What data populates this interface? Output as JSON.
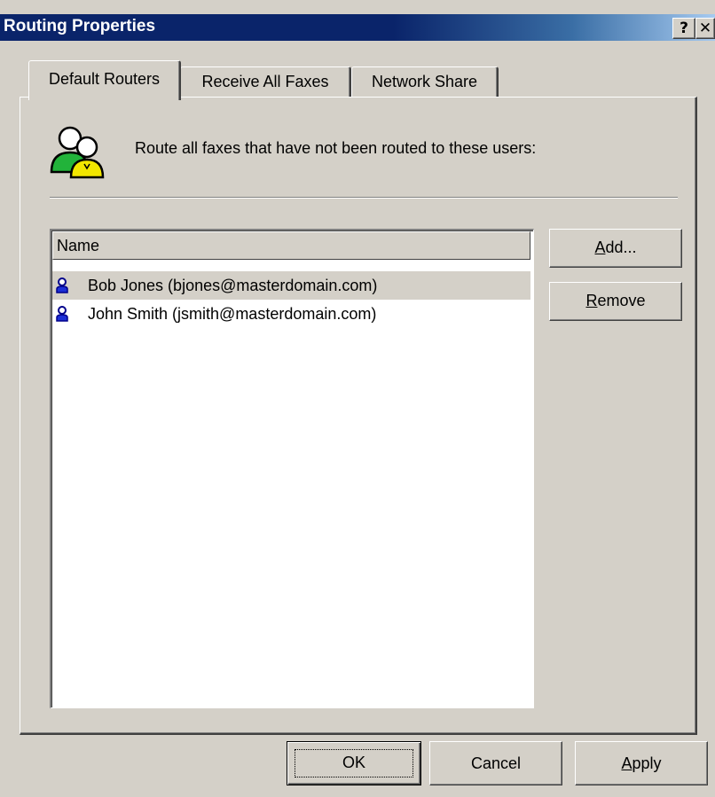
{
  "window": {
    "title": "Routing Properties",
    "help_button": "?",
    "close_button": "✕"
  },
  "tabs": [
    {
      "label": "Default Routers",
      "active": true
    },
    {
      "label": "Receive All Faxes",
      "active": false
    },
    {
      "label": "Network Share",
      "active": false
    }
  ],
  "instruction": "Route all faxes that have not been routed to these users:",
  "list": {
    "column_header": "Name",
    "rows": [
      {
        "text": "Bob Jones (bjones@masterdomain.com)",
        "selected": true
      },
      {
        "text": "John Smith (jsmith@masterdomain.com)",
        "selected": false
      }
    ]
  },
  "buttons": {
    "add": {
      "mnemonic": "A",
      "rest": "dd..."
    },
    "remove": {
      "mnemonic": "R",
      "rest": "emove"
    },
    "ok": "OK",
    "cancel": "Cancel",
    "apply": {
      "mnemonic": "A",
      "rest": "pply"
    }
  },
  "colors": {
    "titlebar_start": "#0a246a",
    "titlebar_end": "#a6caf0",
    "face": "#d4d0c8",
    "list_bg": "#ffffff"
  },
  "icons": {
    "group": "users-group-icon",
    "user": "user-icon"
  }
}
